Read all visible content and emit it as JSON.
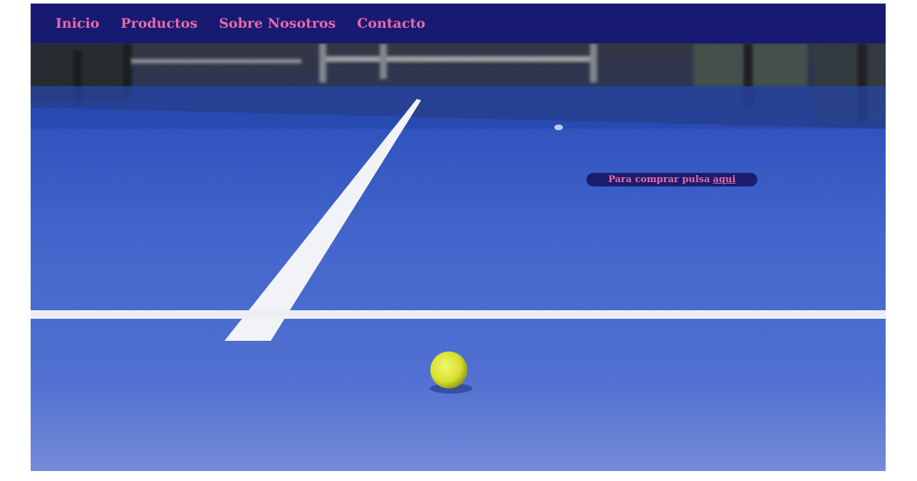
{
  "nav": {
    "items": [
      {
        "label": "Inicio"
      },
      {
        "label": "Productos"
      },
      {
        "label": "Sobre Nosotros"
      },
      {
        "label": "Contacto"
      }
    ]
  },
  "hero": {
    "image": "padel-court-with-tennis-ball",
    "buy_text": "Para comprar pulsa",
    "buy_link": "aqui"
  },
  "colors": {
    "nav_background": "#181a72",
    "nav_text": "#e66aa6",
    "court_blue": "#3a5fc4",
    "ball": "#dfe83a"
  }
}
